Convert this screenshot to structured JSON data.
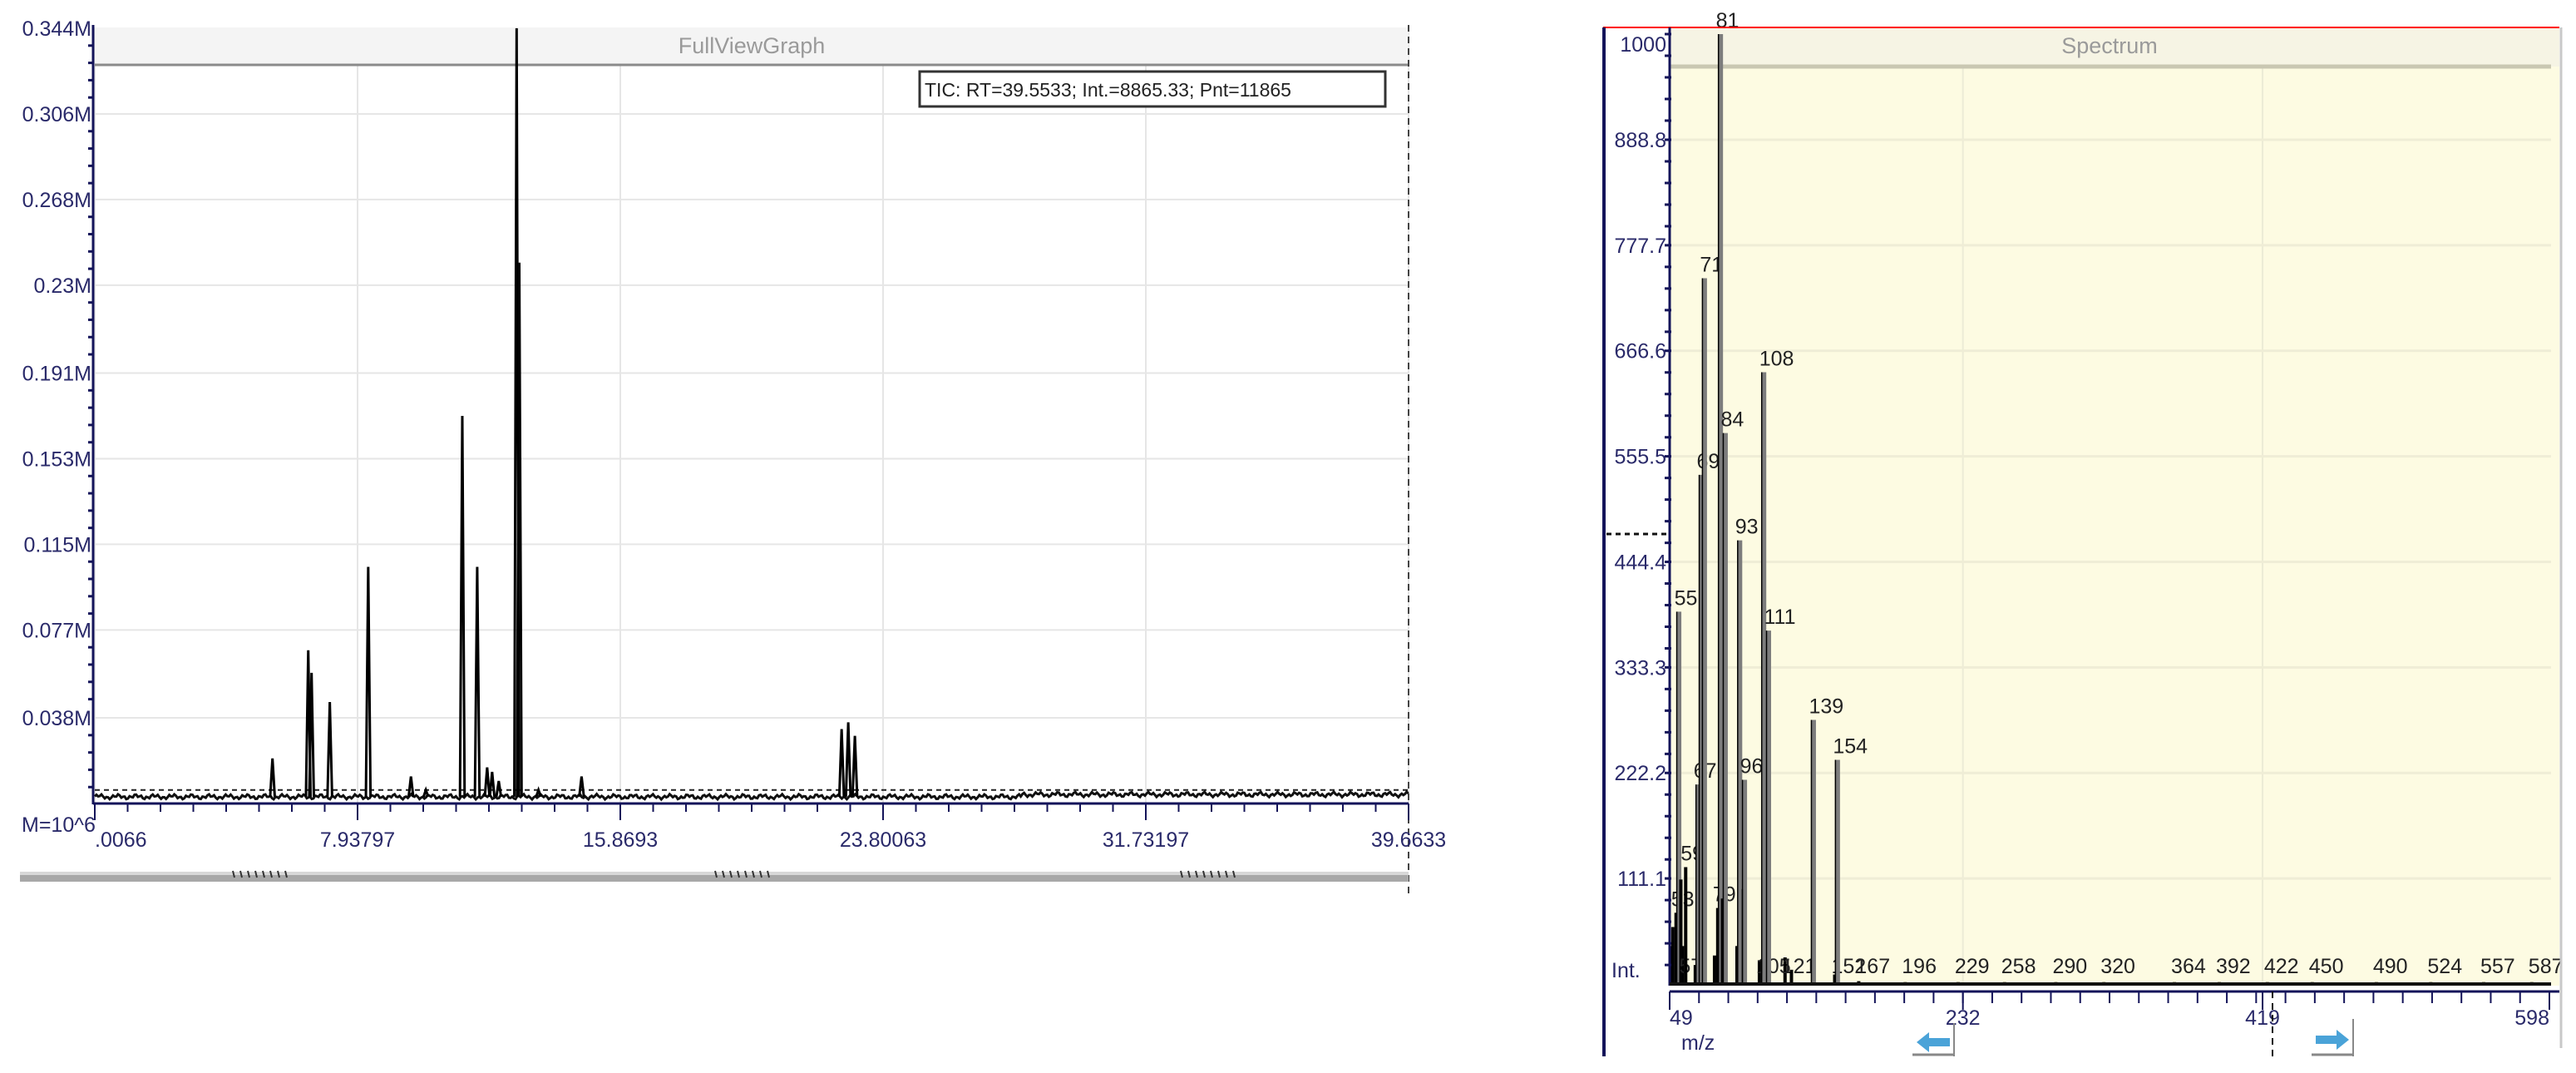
{
  "chart_data": [
    {
      "type": "line",
      "title": "FullViewGraph",
      "legend": "TIC:  RT=39.5533; Int.=8865.33; Pnt=11865",
      "legend_placement": "top-right",
      "ylabel": "M=10^6",
      "xlabel": "",
      "xlim": [
        0.0066,
        39.6633
      ],
      "ylim": [
        0,
        0.344
      ],
      "x_ticks": [
        ".0066",
        "7.93797",
        "15.8693",
        "23.80063",
        "31.73197",
        "39.6633"
      ],
      "x_tick_values": [
        0.0066,
        7.93797,
        15.8693,
        23.80063,
        31.73197,
        39.6633
      ],
      "y_ticks": [
        "0.038M",
        "0.077M",
        "0.115M",
        "0.153M",
        "0.191M",
        "0.23M",
        "0.268M",
        "0.306M",
        "0.344M"
      ],
      "y_tick_values": [
        0.038,
        0.077,
        0.115,
        0.153,
        0.191,
        0.23,
        0.268,
        0.306,
        0.344
      ],
      "baseline": 0.003,
      "threshold": 0.006,
      "peaks": [
        {
          "rt": 5.37,
          "h": 0.02
        },
        {
          "rt": 6.45,
          "h": 0.068
        },
        {
          "rt": 6.55,
          "h": 0.058
        },
        {
          "rt": 7.1,
          "h": 0.045
        },
        {
          "rt": 8.26,
          "h": 0.105
        },
        {
          "rt": 9.55,
          "h": 0.012
        },
        {
          "rt": 10.0,
          "h": 0.006
        },
        {
          "rt": 11.1,
          "h": 0.172
        },
        {
          "rt": 11.55,
          "h": 0.105
        },
        {
          "rt": 11.85,
          "h": 0.016
        },
        {
          "rt": 12.0,
          "h": 0.014
        },
        {
          "rt": 12.2,
          "h": 0.01
        },
        {
          "rt": 12.74,
          "h": 0.344
        },
        {
          "rt": 12.82,
          "h": 0.24
        },
        {
          "rt": 13.4,
          "h": 0.006
        },
        {
          "rt": 14.7,
          "h": 0.012
        },
        {
          "rt": 22.55,
          "h": 0.033
        },
        {
          "rt": 22.75,
          "h": 0.036
        },
        {
          "rt": 22.95,
          "h": 0.03
        }
      ],
      "grid": true
    },
    {
      "type": "bar",
      "title": "Spectrum",
      "xlabel": "m/z",
      "ylabel": "Int.",
      "xlim": [
        49,
        598
      ],
      "ylim": [
        0,
        1000
      ],
      "x_ticks": [
        "49",
        "232",
        "419",
        "598"
      ],
      "x_tick_values": [
        49,
        232,
        419,
        598
      ],
      "y_ticks": [
        "111.1",
        "222.2",
        "333.3",
        "444.4",
        "555.5",
        "666.6",
        "777.7",
        "888.8",
        "1000"
      ],
      "y_tick_values": [
        111.1,
        222.2,
        333.3,
        444.4,
        555.5,
        666.6,
        777.7,
        888.8,
        1000
      ],
      "peaks": [
        {
          "mz": 50,
          "i": 40,
          "label": ""
        },
        {
          "mz": 51,
          "i": 60,
          "label": ""
        },
        {
          "mz": 53,
          "i": 75,
          "label": "53"
        },
        {
          "mz": 55,
          "i": 392,
          "label": "55"
        },
        {
          "mz": 56,
          "i": 110,
          "label": ""
        },
        {
          "mz": 57,
          "i": 40,
          "label": "57"
        },
        {
          "mz": 59,
          "i": 123,
          "label": "59"
        },
        {
          "mz": 65,
          "i": 20,
          "label": ""
        },
        {
          "mz": 67,
          "i": 210,
          "label": "67"
        },
        {
          "mz": 69,
          "i": 536,
          "label": "69"
        },
        {
          "mz": 71,
          "i": 743,
          "label": "71"
        },
        {
          "mz": 77,
          "i": 30,
          "label": ""
        },
        {
          "mz": 79,
          "i": 80,
          "label": "79"
        },
        {
          "mz": 81,
          "i": 1000,
          "label": "81"
        },
        {
          "mz": 82,
          "i": 90,
          "label": ""
        },
        {
          "mz": 84,
          "i": 580,
          "label": "84"
        },
        {
          "mz": 91,
          "i": 40,
          "label": ""
        },
        {
          "mz": 93,
          "i": 467,
          "label": "93"
        },
        {
          "mz": 95,
          "i": 100,
          "label": ""
        },
        {
          "mz": 96,
          "i": 215,
          "label": "96"
        },
        {
          "mz": 105,
          "i": 25,
          "label": "105"
        },
        {
          "mz": 108,
          "i": 644,
          "label": "108"
        },
        {
          "mz": 111,
          "i": 372,
          "label": "111"
        },
        {
          "mz": 121,
          "i": 28,
          "label": "121"
        },
        {
          "mz": 125,
          "i": 15,
          "label": ""
        },
        {
          "mz": 139,
          "i": 278,
          "label": "139"
        },
        {
          "mz": 152,
          "i": 10,
          "label": "152"
        },
        {
          "mz": 154,
          "i": 236,
          "label": "154"
        },
        {
          "mz": 167,
          "i": 3,
          "label": "167"
        },
        {
          "mz": 196,
          "i": 2,
          "label": "196"
        },
        {
          "mz": 229,
          "i": 2,
          "label": "229"
        },
        {
          "mz": 258,
          "i": 2,
          "label": "258"
        },
        {
          "mz": 290,
          "i": 2,
          "label": "290"
        },
        {
          "mz": 320,
          "i": 2,
          "label": "320"
        },
        {
          "mz": 364,
          "i": 2,
          "label": "364"
        },
        {
          "mz": 392,
          "i": 2,
          "label": "392"
        },
        {
          "mz": 422,
          "i": 2,
          "label": "422"
        },
        {
          "mz": 450,
          "i": 2,
          "label": "450"
        },
        {
          "mz": 490,
          "i": 2,
          "label": "490"
        },
        {
          "mz": 524,
          "i": 2,
          "label": "524"
        },
        {
          "mz": 557,
          "i": 2,
          "label": "557"
        },
        {
          "mz": 587,
          "i": 2,
          "label": "587"
        }
      ],
      "grid": true
    }
  ],
  "colors": {
    "axis": "#14145a",
    "spectrum_bg": "#fdfbe2",
    "spectrum_border": "#ff0000",
    "bar": "#7d7d7d",
    "arrow": "#4aa3d8"
  },
  "icons": {
    "scroll_left": "arrow-left-icon",
    "scroll_right": "arrow-right-icon"
  }
}
